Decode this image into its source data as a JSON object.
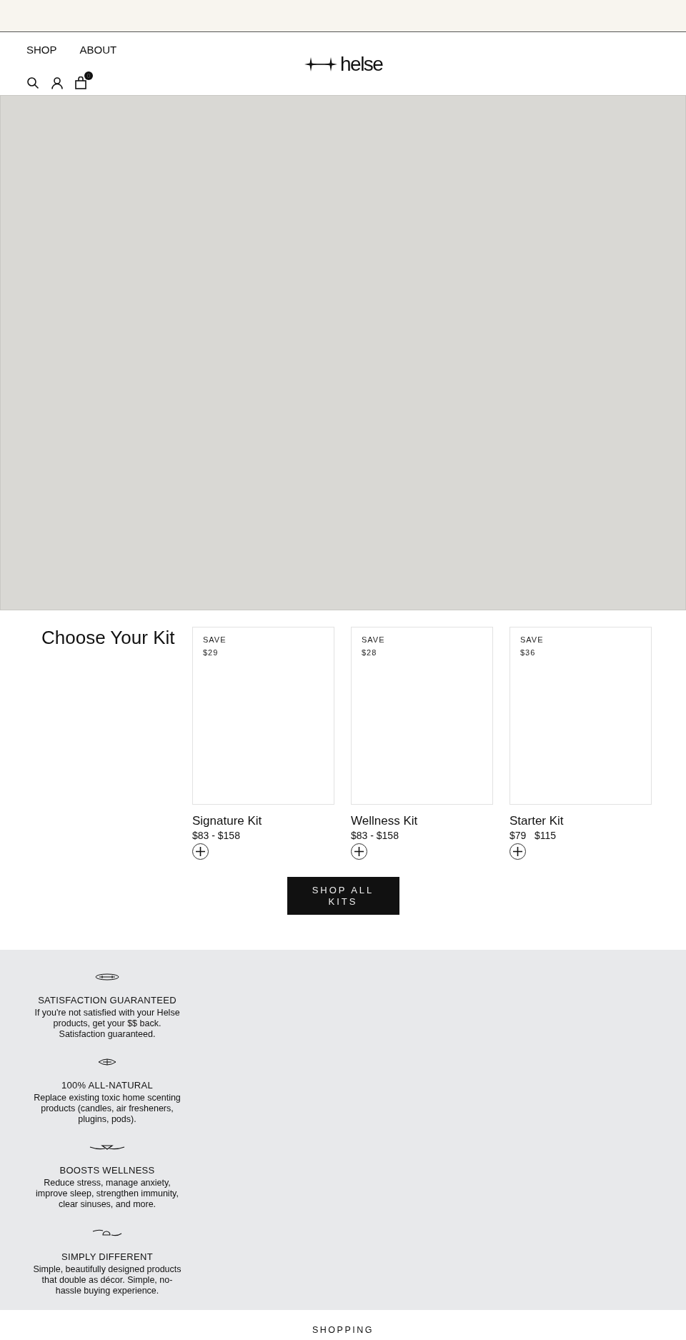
{
  "header": {
    "nav": [
      {
        "label": "SHOP"
      },
      {
        "label": "ABOUT"
      }
    ],
    "cart_count": "0",
    "logo": "helse"
  },
  "kits": {
    "title": "Choose Your Kit",
    "products": [
      {
        "badge": "SAVE",
        "saving": "$29",
        "name": "Signature Kit",
        "price": "$83 - $158"
      },
      {
        "badge": "SAVE",
        "saving": "$28",
        "name": "Wellness Kit",
        "price": "$83 - $158"
      },
      {
        "badge": "SAVE",
        "saving": "$36",
        "name": "Starter Kit",
        "price": "$79   $115"
      }
    ],
    "button": "SHOP ALL KITS"
  },
  "features": [
    {
      "title": "SATISFACTION GUARANTEED",
      "text": "If you're not satisfied with your Helse products, get your $$ back. Satisfaction guaranteed."
    },
    {
      "title": "100% ALL-NATURAL",
      "text": "Replace existing toxic home scenting products (candles, air fresheners, plugins, pods)."
    },
    {
      "title": "BOOSTS WELLNESS",
      "text": "Reduce stress, manage anxiety, improve sleep, strengthen immunity, clear sinuses, and more."
    },
    {
      "title": "SIMPLY DIFFERENT",
      "text": "Simple, beautifully designed products that double as décor. Simple, no-hassle buying experience."
    }
  ],
  "footer": {
    "heading": "SHOPPING"
  }
}
